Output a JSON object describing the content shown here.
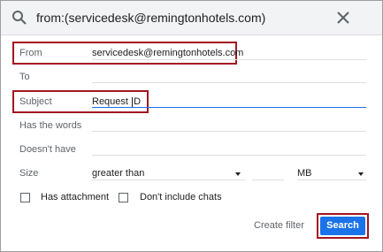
{
  "search": {
    "query": "from:(servicedesk@remingtonhotels.com)"
  },
  "form": {
    "from": {
      "label": "From",
      "value": "servicedesk@remingtonhotels.com"
    },
    "to": {
      "label": "To",
      "value": ""
    },
    "subject": {
      "label": "Subject",
      "value": "Request ID"
    },
    "has_words": {
      "label": "Has the words",
      "value": ""
    },
    "doesnt_have": {
      "label": "Doesn't have",
      "value": ""
    },
    "size": {
      "label": "Size",
      "operator": "greater than",
      "amount": "",
      "unit": "MB"
    },
    "has_attachment": {
      "label": "Has attachment",
      "checked": false
    },
    "dont_include_chats": {
      "label": "Don't include chats",
      "checked": false
    }
  },
  "actions": {
    "create_filter": "Create filter",
    "search": "Search"
  },
  "colors": {
    "accent": "#1a73e8",
    "highlight": "#a31621"
  }
}
